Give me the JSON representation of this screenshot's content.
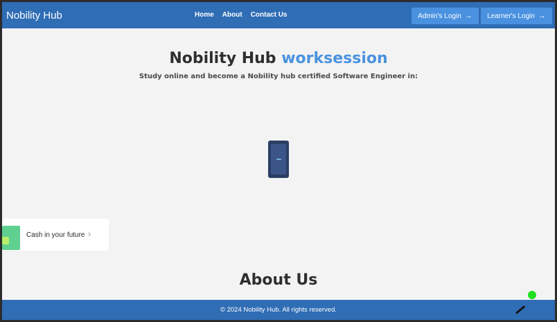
{
  "header": {
    "brand": "Nobility Hub",
    "nav": [
      "Home",
      "About",
      "Contact Us"
    ],
    "admin_login": "Admin's Login",
    "learner_login": "Learner's Login",
    "arrow_icon": "→"
  },
  "hero": {
    "title_main": "Nobility Hub",
    "title_accent": "worksession",
    "subtitle": "Study online and become a Nobility hub certified Software Engineer in:"
  },
  "card": {
    "text": "Cash in your future",
    "chevron": "›"
  },
  "about": {
    "title": "About Us"
  },
  "footer": {
    "text": "© 2024 Nobility Hub. All rights reserved."
  },
  "colors": {
    "navbar": "#2f6db5",
    "button": "#4a92e0",
    "accent": "#4a92e0",
    "background": "#f3f3f3",
    "green_dot": "#21e021"
  }
}
